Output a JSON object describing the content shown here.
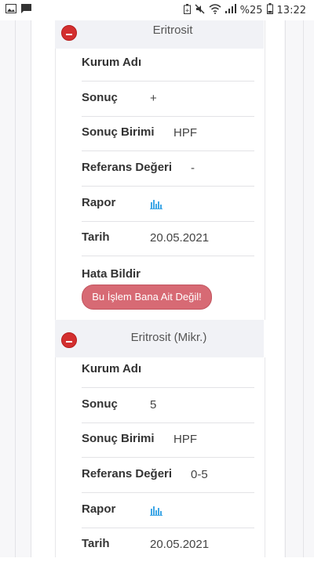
{
  "status_bar": {
    "battery": "%25",
    "time": "13:22",
    "icons": [
      "image-icon",
      "message-icon",
      "battery-saver-icon",
      "mute-icon",
      "wifi-icon",
      "signal-icon",
      "battery-icon"
    ]
  },
  "labels": {
    "kurum_adi": "Kurum Adı",
    "sonuc": "Sonuç",
    "sonuc_birimi": "Sonuç Birimi",
    "referans_degeri": "Referans Değeri",
    "rapor": "Rapor",
    "tarih": "Tarih",
    "hata_bildir": "Hata Bildir"
  },
  "tests": [
    {
      "title": "Eritrosit",
      "kurum_adi": "",
      "sonuc": "+",
      "sonuc_birimi": "HPF",
      "referans_degeri": "-",
      "rapor_icon": "bar-chart-icon",
      "tarih": "20.05.2021",
      "report_button": "Bu İşlem Bana Ait Değil!"
    },
    {
      "title": "Eritrosit (Mikr.)",
      "kurum_adi": "",
      "sonuc": "5",
      "sonuc_birimi": "HPF",
      "referans_degeri": "0-5",
      "rapor_icon": "bar-chart-icon",
      "tarih": "20.05.2021"
    }
  ],
  "colors": {
    "accent_red": "#d32f2f",
    "button_pink": "#d76a74",
    "chart_icon_blue": "#3fa7e6"
  }
}
